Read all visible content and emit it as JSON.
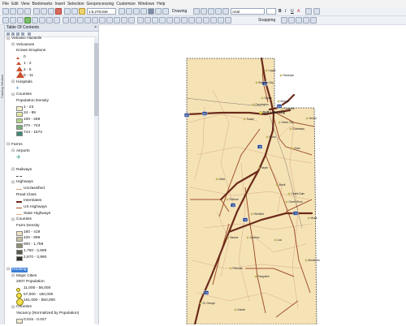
{
  "menu": [
    "File",
    "Edit",
    "View",
    "Bookmarks",
    "Insert",
    "Selection",
    "Geoprocessing",
    "Customize",
    "Windows",
    "Help"
  ],
  "toolbar": {
    "scale": "1:5,278,846",
    "drawing_label": "Drawing",
    "font": "Arial",
    "bold": "B",
    "italic": "I",
    "underline": "U",
    "font_letter": "A",
    "snapping_label": "Snapping"
  },
  "side_tab": "Catalog Window",
  "toc": {
    "title": "Table Of Contents",
    "close": "×",
    "layers": [
      {
        "indent": 0,
        "label": "Volcanic Hazards",
        "sym": "grp"
      },
      {
        "indent": 1,
        "label": "Volcanoes",
        "sym": "grp"
      },
      {
        "indent": 2,
        "label": "Known Eruptions",
        "sym": ""
      },
      {
        "indent": 2,
        "label": "0",
        "sym": "tri-s"
      },
      {
        "indent": 2,
        "label": "1 - 2",
        "sym": "tri-m"
      },
      {
        "indent": 2,
        "label": "4 - 5",
        "sym": "tri-l"
      },
      {
        "indent": 2,
        "label": "6 - 11",
        "sym": "tri-xl"
      },
      {
        "indent": 1,
        "label": "Hospitals",
        "sym": "grp"
      },
      {
        "indent": 2,
        "label": "",
        "sym": "plus"
      },
      {
        "indent": 1,
        "label": "Counties",
        "sym": "grp"
      },
      {
        "indent": 2,
        "label": "Population Density",
        "sym": ""
      },
      {
        "indent": 2,
        "label": "1 - 23",
        "sym": "box-1"
      },
      {
        "indent": 2,
        "label": "24 - 99",
        "sym": "box-2"
      },
      {
        "indent": 2,
        "label": "100 - 269",
        "sym": "box-3"
      },
      {
        "indent": 2,
        "label": "270 - 743",
        "sym": "box-4"
      },
      {
        "indent": 2,
        "label": "744 - 1573",
        "sym": "box-5"
      },
      {
        "indent": 0,
        "label": "",
        "sym": ""
      },
      {
        "indent": 0,
        "label": "Farms",
        "sym": "grp"
      },
      {
        "indent": 1,
        "label": "Airports",
        "sym": "grp"
      },
      {
        "indent": 2,
        "label": "",
        "sym": "plane"
      },
      {
        "indent": 0,
        "label": "",
        "sym": ""
      },
      {
        "indent": 1,
        "label": "Railways",
        "sym": "grp"
      },
      {
        "indent": 2,
        "label": "",
        "sym": "rail"
      },
      {
        "indent": 1,
        "label": "Highways",
        "sym": "grp"
      },
      {
        "indent": 2,
        "label": "Unclassified",
        "sym": "line-thin"
      },
      {
        "indent": 2,
        "label": "Road Class",
        "sym": ""
      },
      {
        "indent": 2,
        "label": "Interstates",
        "sym": "line-thick"
      },
      {
        "indent": 2,
        "label": "US Highways",
        "sym": "line-med"
      },
      {
        "indent": 2,
        "label": "State Highways",
        "sym": "line-light"
      },
      {
        "indent": 1,
        "label": "Counties",
        "sym": "grp"
      },
      {
        "indent": 2,
        "label": "Farm Density",
        "sym": ""
      },
      {
        "indent": 2,
        "label": "160 - 419",
        "sym": "farm-1"
      },
      {
        "indent": 2,
        "label": "420 - 899",
        "sym": "farm-2"
      },
      {
        "indent": 2,
        "label": "900 - 1,759",
        "sym": "farm-3"
      },
      {
        "indent": 2,
        "label": "1,760 - 2,669",
        "sym": "farm-4"
      },
      {
        "indent": 2,
        "label": "2,670 - 3,990",
        "sym": "farm-5"
      },
      {
        "indent": 0,
        "label": "",
        "sym": ""
      },
      {
        "indent": 0,
        "label": "Housing",
        "sym": "grp-sel"
      },
      {
        "indent": 1,
        "label": "Major Cities",
        "sym": "grp"
      },
      {
        "indent": 2,
        "label": "2007 Population",
        "sym": ""
      },
      {
        "indent": 2,
        "label": "11,000 - 56,000",
        "sym": "circ-s"
      },
      {
        "indent": 2,
        "label": "57,000 - 150,000",
        "sym": "circ-m"
      },
      {
        "indent": 2,
        "label": "151,000 - 550,000",
        "sym": "circ-l"
      },
      {
        "indent": 1,
        "label": "Counties",
        "sym": "grp"
      },
      {
        "indent": 2,
        "label": "Vacancy (Normalized by Population)",
        "sym": ""
      },
      {
        "indent": 2,
        "label": "0.015 - 0.027",
        "sym": "box-v1"
      }
    ]
  },
  "map": {
    "cities": [
      {
        "name": "Logan"
      },
      {
        "name": "Brigham City"
      },
      {
        "name": "Ogden"
      },
      {
        "name": "Farmington"
      },
      {
        "name": "Morgan"
      },
      {
        "name": "Salt Lake City"
      },
      {
        "name": "Coalville"
      },
      {
        "name": "Heber City"
      },
      {
        "name": "Vernal"
      },
      {
        "name": "Provo"
      },
      {
        "name": "Duchesne"
      },
      {
        "name": "Tooele"
      },
      {
        "name": "Nephi"
      },
      {
        "name": "Price"
      },
      {
        "name": "Manti"
      },
      {
        "name": "Castle Dale"
      },
      {
        "name": "Fillmore"
      },
      {
        "name": "Richfield"
      },
      {
        "name": "Junction"
      },
      {
        "name": "Beaver"
      },
      {
        "name": "Loa"
      },
      {
        "name": "Moab"
      },
      {
        "name": "Parowan"
      },
      {
        "name": "Panguitch"
      },
      {
        "name": "Monticello"
      },
      {
        "name": "St. George"
      },
      {
        "name": "Kanab"
      },
      {
        "name": "Randolph"
      },
      {
        "name": "Green River"
      },
      {
        "name": "Delta"
      }
    ],
    "shields": [
      "15",
      "80",
      "84",
      "70",
      "15",
      "15",
      "80",
      "70",
      "15"
    ]
  },
  "colors": {
    "state_fill": "#f5e3b6",
    "interstate": "#6b2a1a",
    "highway": "#a0522d",
    "minor_road": "#d8a98a",
    "selection": "#3a7fd6"
  }
}
